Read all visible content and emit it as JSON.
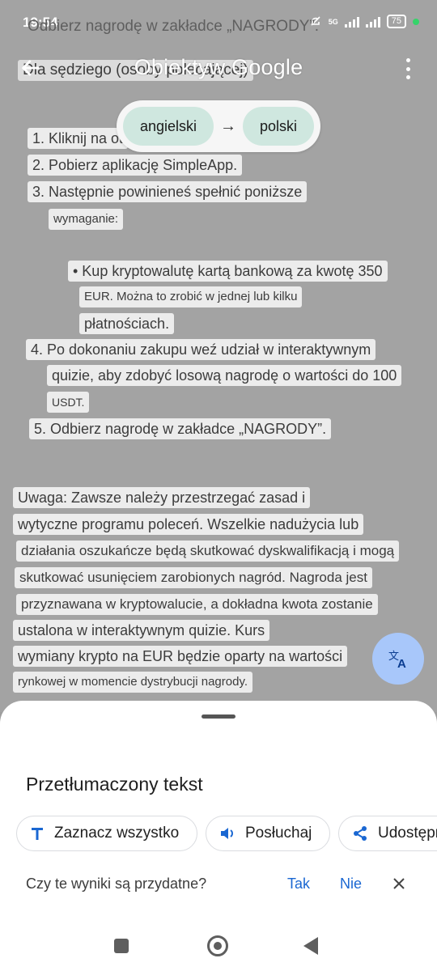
{
  "status": {
    "time": "19:54",
    "network": "5G",
    "battery": "75"
  },
  "lens": {
    "title": "Obiektyw Google",
    "source_lang": "angielski",
    "target_lang": "polski",
    "arrow": "→"
  },
  "overlay": {
    "line_top": "Odbierz nagrodę w zakładce „NAGRODY”.",
    "line_header": "Dla sędziego (osoby polecającej)",
    "l1": "1. Kliknij na ot",
    "l2": "2. Pobierz aplikację SimpleApp.",
    "l3a": "3. Następnie powinieneś spełnić poniższe",
    "l3b": "wymaganie:",
    "b1a": "• Kup kryptowalutę kartą bankową za kwotę 350",
    "b1b": "EUR. Można to zrobić w jednej lub kilku",
    "b1c": "płatnościach.",
    "l4a": "4. Po dokonaniu zakupu weź udział w interaktywnym",
    "l4b": "quizie, aby zdobyć losową nagrodę o wartości do 100",
    "l4c": "USDT.",
    "l5": "5. Odbierz nagrodę w zakładce „NAGRODY”.",
    "n1": "Uwaga: Zawsze należy przestrzegać zasad i",
    "n2": "wytyczne programu poleceń. Wszelkie nadużycia lub",
    "n3": "działania oszukańcze będą skutkować dyskwalifikacją i mogą",
    "n4": "skutkować usunięciem zarobionych nagród. Nagroda jest",
    "n5": "przyznawana w kryptowalucie, a dokładna kwota zostanie",
    "n6": "ustalona w interaktywnym quizie. Kurs",
    "n7": "wymiany krypto na EUR będzie oparty na wartości",
    "n8": "rynkowej w momencie dystrybucji nagrody."
  },
  "sheet": {
    "title": "Przetłumaczony tekst",
    "select_all": "Zaznacz wszystko",
    "listen": "Posłuchaj",
    "share": "Udostępnij",
    "feedback_question": "Czy te wyniki są przydatne?",
    "yes": "Tak",
    "no": "Nie"
  },
  "colors": {
    "accent": "#1a67d2",
    "chip_lang": "#cfe7df",
    "fab": "#a8c7fa"
  },
  "icons": {
    "back": "arrow-back-icon",
    "more": "more-vert-icon",
    "translate": "translate-icon",
    "text": "text-t-icon",
    "speaker": "volume-icon",
    "share": "share-icon",
    "close": "close-icon"
  }
}
